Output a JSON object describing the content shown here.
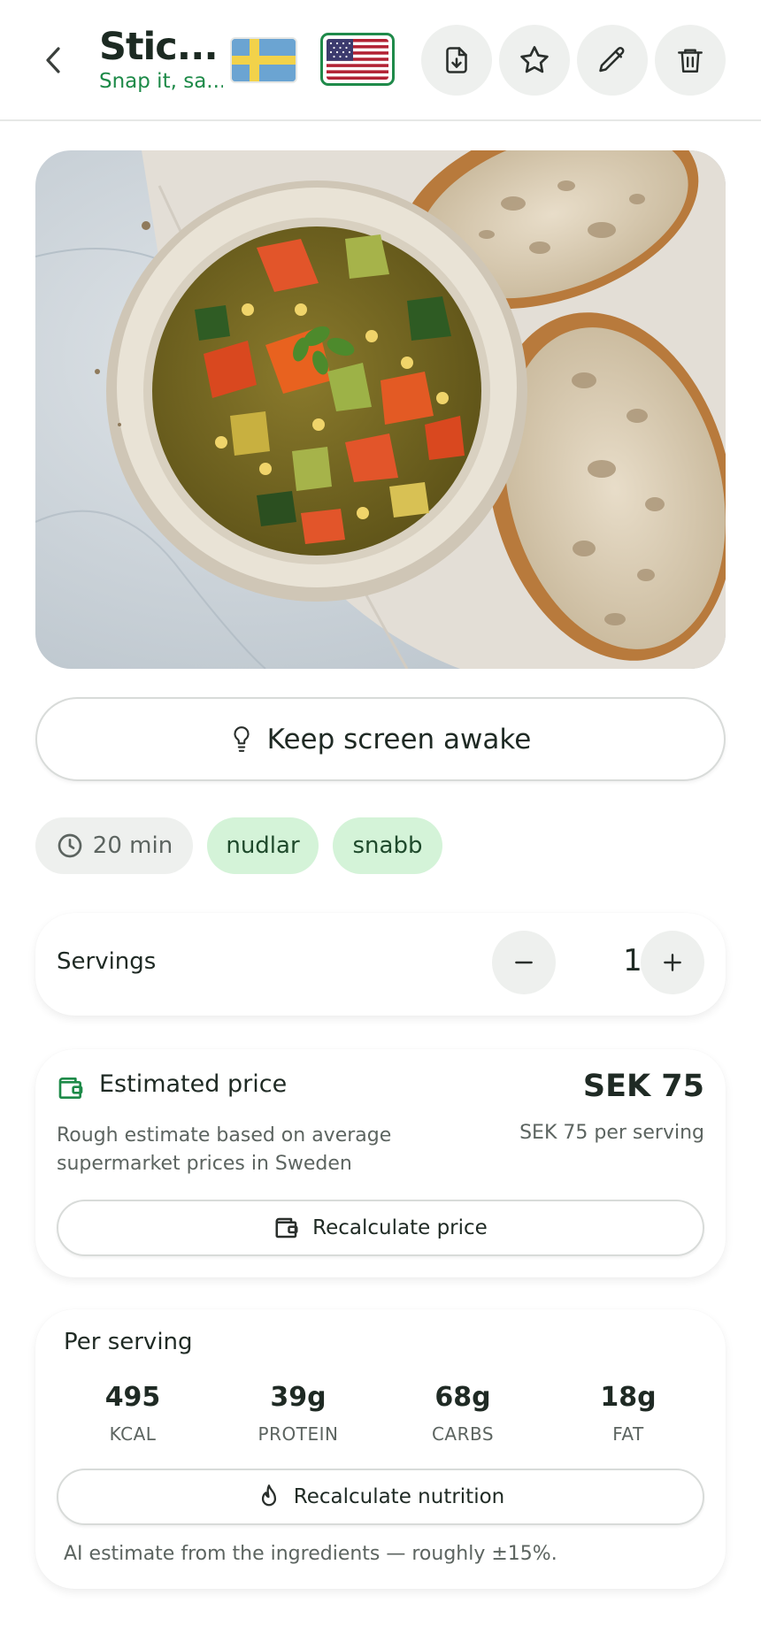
{
  "header": {
    "title": "Stic...",
    "subtitle": "Snap it, sa...",
    "languages": [
      {
        "code": "sv",
        "icon": "swedish-flag-icon",
        "selected": false
      },
      {
        "code": "en",
        "icon": "us-flag-icon",
        "selected": true
      }
    ],
    "actions": [
      "download-icon",
      "star-icon",
      "pencil-icon",
      "trash-icon"
    ]
  },
  "awake": {
    "label": "Keep screen awake"
  },
  "chips": {
    "time": "20 min",
    "tags": [
      "nudlar",
      "snabb"
    ]
  },
  "servings": {
    "label": "Servings",
    "value": "1"
  },
  "price": {
    "title": "Estimated price",
    "amount": "SEK 75",
    "description": "Rough estimate based on average supermarket prices in Sweden",
    "per_serving": "SEK 75 per serving",
    "button": "Recalculate price"
  },
  "nutrition": {
    "title": "Per serving",
    "macros": [
      {
        "value": "495",
        "label": "KCAL"
      },
      {
        "value": "39g",
        "label": "PROTEIN"
      },
      {
        "value": "68g",
        "label": "CARBS"
      },
      {
        "value": "18g",
        "label": "FAT"
      }
    ],
    "button": "Recalculate nutrition",
    "note": "AI estimate from the ingredients — roughly ±15%."
  },
  "colors": {
    "accent_green": "#1d8a48",
    "tag_bg": "#d4f3d8",
    "button_bg": "#eef0ee"
  }
}
